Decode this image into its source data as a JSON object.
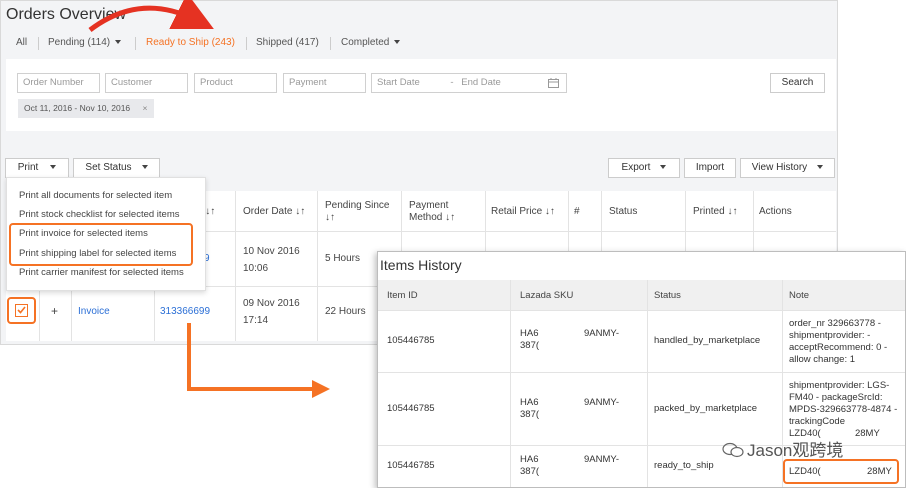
{
  "orders": {
    "title": "Orders Overview",
    "tabs": [
      {
        "label": "All"
      },
      {
        "label": "Pending (114)"
      },
      {
        "label": "Ready to Ship (243)"
      },
      {
        "label": "Shipped (417)"
      },
      {
        "label": "Completed"
      }
    ],
    "filters": {
      "order_number": "Order Number",
      "customer": "Customer",
      "product": "Product",
      "payment": "Payment",
      "start_date": "Start Date",
      "date_sep": "-",
      "end_date": "End Date",
      "search": "Search",
      "date_chip": "Oct 11, 2016 - Nov 10, 2016",
      "chip_close": "×"
    },
    "toolbar": {
      "print": "Print",
      "set_status": "Set Status",
      "export": "Export",
      "import": "Import",
      "view_history": "View History"
    },
    "print_menu": [
      "Print all documents for selected item",
      "Print stock checklist for selected items",
      "Print invoice for selected items",
      "Print shipping label for selected items",
      "Print carrier manifest for selected items"
    ],
    "columns": {
      "order_number_tail": "l↓↑",
      "order_date": "Order Date ↓↑",
      "pending_since_1": "Pending Since",
      "pending_since_2": "↓↑",
      "payment_1": "Payment",
      "payment_2": "Method ↓↑",
      "retail_price": "Retail Price ↓↑",
      "count": "#",
      "status": "Status",
      "printed": "Printed ↓↑",
      "actions": "Actions"
    },
    "rows": [
      {
        "order_tail": "9",
        "date": "10 Nov 2016",
        "time": "10:06",
        "pending": "5 Hours"
      },
      {
        "add": "+",
        "invoice": "Invoice",
        "order": "313366699",
        "date": "09 Nov 2016",
        "time": "17:14",
        "pending": "22 Hours"
      }
    ]
  },
  "history": {
    "title": "Items History",
    "columns": [
      "Item ID",
      "Lazada SKU",
      "Status",
      "Note"
    ],
    "rows": [
      {
        "item_id": "105446785",
        "sku_a": "HA6",
        "sku_b": "387(",
        "sku_c": "9ANMY-",
        "status": "handled_by_marketplace",
        "note": [
          "order_nr 329663778 -",
          "shipmentprovider: -",
          "acceptRecommend: 0 -",
          "allow change: 1"
        ]
      },
      {
        "item_id": "105446785",
        "sku_a": "HA6",
        "sku_b": "387(",
        "sku_c": "9ANMY-",
        "status": "packed_by_marketplace",
        "note": [
          "shipmentprovider: LGS-",
          "FM40 - packageSrcId:",
          "MPDS-329663778-4874 -",
          "trackingCode",
          "LZD40(             28MY"
        ]
      },
      {
        "item_id": "105446785",
        "sku_a": "HA6",
        "sku_b": "387(",
        "sku_c": "9ANMY-",
        "status": "ready_to_ship",
        "note": [
          "LZD40(",
          "28MY"
        ]
      }
    ]
  },
  "watermark": "Jason观跨境",
  "colors": {
    "accent": "#f57224",
    "link": "#2b6fd6",
    "annotation_red": "#e53222"
  }
}
